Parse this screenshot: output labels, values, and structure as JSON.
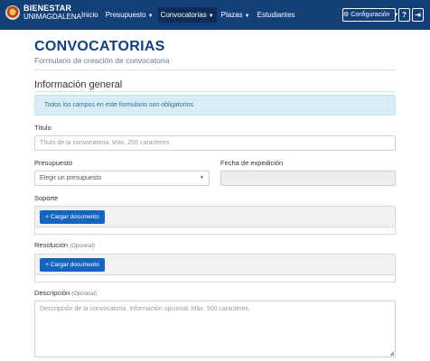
{
  "navbar": {
    "brand_line1": "BIENESTAR",
    "brand_line2": "UNIMAGDALENA",
    "items": [
      {
        "label": "Inicio",
        "dropdown": false
      },
      {
        "label": "Presupuesto",
        "dropdown": true
      },
      {
        "label": "Convocatorias",
        "dropdown": true,
        "active": true
      },
      {
        "label": "Plazas",
        "dropdown": true
      },
      {
        "label": "Estudiantes",
        "dropdown": false
      }
    ],
    "config_label": "Configuración",
    "help_glyph": "?",
    "logout_glyph": "⇥",
    "bg_color": "#14407a"
  },
  "page": {
    "title": "CONVOCATORIAS",
    "subtitle": "Formulario de creación de convocatoria",
    "section_title": "Información general",
    "alert_text": "Todos los campos en este formulario son obligatorios"
  },
  "form": {
    "titulo_label": "Título",
    "titulo_placeholder": "Título de la convocatoria. Máx. 255 caracteres",
    "presupuesto_label": "Presupuesto",
    "presupuesto_value": "Elegir un presupuesto",
    "fecha_label": "Fecha de expedición",
    "fecha_value": "",
    "soporte_label": "Soporte",
    "soporte_button": "+ Cargar documento",
    "resolucion_label": "Resolución",
    "resolucion_optional": "(Opcional)",
    "resolucion_button": "+ Cargar documento",
    "descripcion_label": "Descripción",
    "descripcion_optional": "(Opcional)",
    "descripcion_placeholder": "Descripción de la convocatoria. Información opcional. Máx. 500 caracteres."
  },
  "icons": {
    "config": "gear-icon",
    "caret": "caret-down-icon",
    "help": "question-icon",
    "logout": "sign-out-icon"
  }
}
